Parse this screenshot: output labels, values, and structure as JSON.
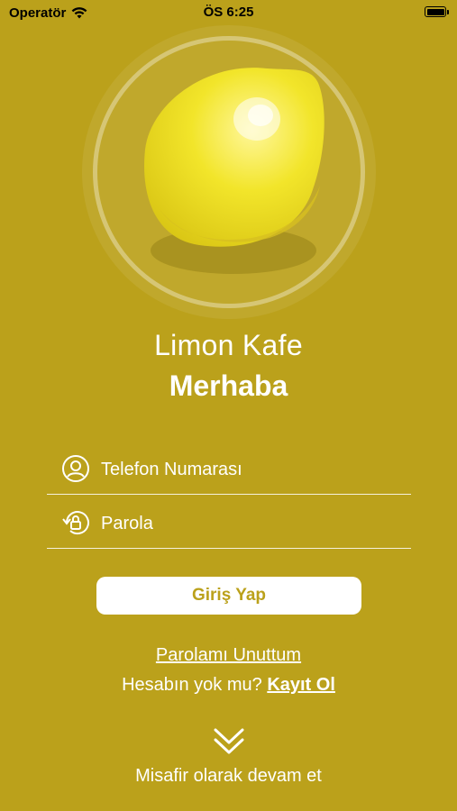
{
  "status_bar": {
    "carrier": "Operatör",
    "time": "ÖS 6:25"
  },
  "app": {
    "name": "Limon Kafe",
    "greeting": "Merhaba"
  },
  "form": {
    "phone_placeholder": "Telefon Numarası",
    "password_placeholder": "Parola"
  },
  "actions": {
    "login_label": "Giriş Yap",
    "forgot_label": "Parolamı Unuttum",
    "no_account_text": "Hesabın yok mu?",
    "signup_label": "Kayıt Ol",
    "guest_label": "Misafir olarak devam et"
  },
  "colors": {
    "background": "#BBA11B",
    "accent": "#FFFFFF",
    "lemon": "#F2E52A"
  },
  "icons": [
    "wifi-icon",
    "battery-icon",
    "user-icon",
    "password-reset-icon",
    "chevron-down-icon"
  ]
}
